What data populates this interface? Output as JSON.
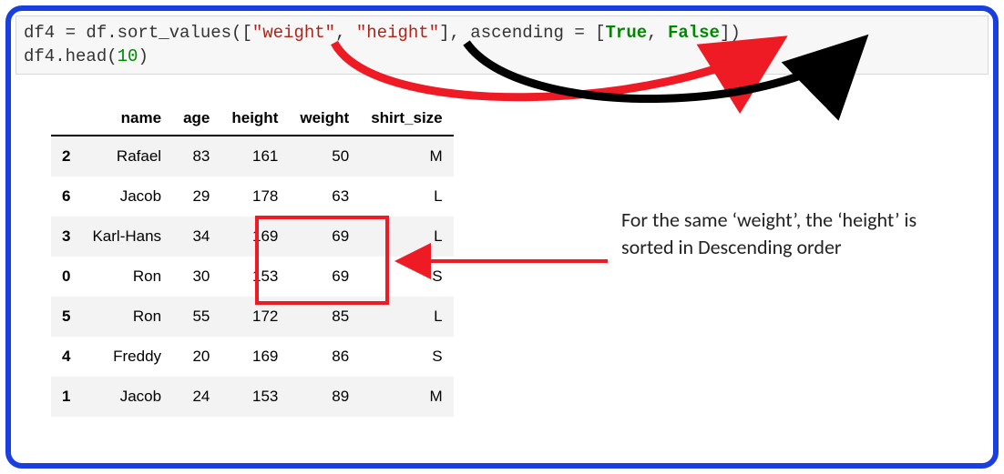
{
  "code": {
    "line1_parts": {
      "p1": "df4 = df.sort_values([",
      "s1": "\"weight\"",
      "comma1": ", ",
      "s2": "\"height\"",
      "p2": "], ascending = [",
      "kw1": "True",
      "comma2": ", ",
      "kw2": "False",
      "p3": "])"
    },
    "line2_pre": "df4.head(",
    "line2_num": "10",
    "line2_post": ")"
  },
  "table": {
    "columns": [
      "name",
      "age",
      "height",
      "weight",
      "shirt_size"
    ],
    "rows": [
      {
        "idx": "2",
        "name": "Rafael",
        "age": "83",
        "height": "161",
        "weight": "50",
        "shirt_size": "M"
      },
      {
        "idx": "6",
        "name": "Jacob",
        "age": "29",
        "height": "178",
        "weight": "63",
        "shirt_size": "L"
      },
      {
        "idx": "3",
        "name": "Karl-Hans",
        "age": "34",
        "height": "169",
        "weight": "69",
        "shirt_size": "L"
      },
      {
        "idx": "0",
        "name": "Ron",
        "age": "30",
        "height": "153",
        "weight": "69",
        "shirt_size": "S"
      },
      {
        "idx": "5",
        "name": "Ron",
        "age": "55",
        "height": "172",
        "weight": "85",
        "shirt_size": "L"
      },
      {
        "idx": "4",
        "name": "Freddy",
        "age": "20",
        "height": "169",
        "weight": "86",
        "shirt_size": "S"
      },
      {
        "idx": "1",
        "name": "Jacob",
        "age": "24",
        "height": "153",
        "weight": "89",
        "shirt_size": "M"
      }
    ]
  },
  "annotation": {
    "text": "For the same ‘weight’, the ‘height’ is sorted in Descending order"
  },
  "colors": {
    "border_blue": "#1a3fe0",
    "highlight_red": "#ee1b24",
    "arrow_black": "#000000"
  }
}
